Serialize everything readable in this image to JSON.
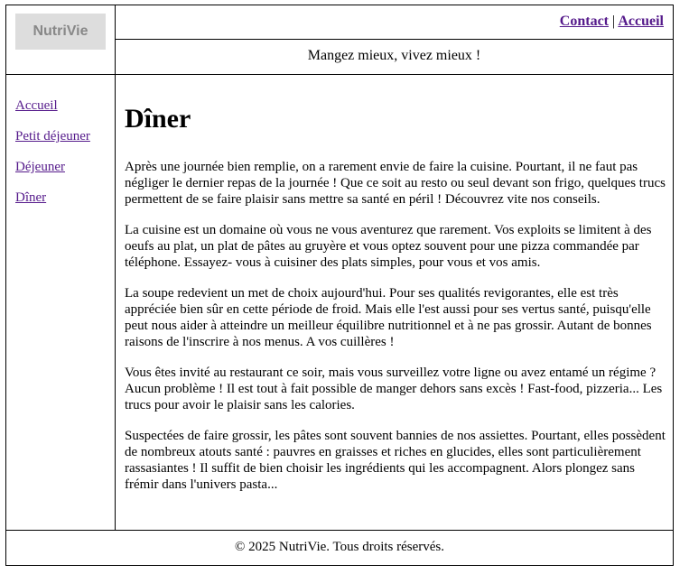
{
  "header": {
    "logo": "NutriVie",
    "nav": [
      {
        "label": "Contact"
      },
      {
        "label": "Accueil"
      }
    ],
    "separator": "|",
    "tagline": "Mangez mieux, vivez mieux !"
  },
  "sidebar": {
    "items": [
      {
        "label": "Accueil"
      },
      {
        "label": "Petit déjeuner"
      },
      {
        "label": "Déjeuner"
      },
      {
        "label": "Dîner"
      }
    ]
  },
  "main": {
    "title": "Dîner",
    "paragraphs": [
      "Après une journée bien remplie, on a rarement envie de faire la cuisine. Pourtant, il ne faut pas négliger le dernier repas de la journée ! Que ce soit au resto ou seul devant son frigo, quelques trucs permettent de se faire plaisir sans mettre sa santé en péril ! Découvrez vite nos conseils.",
      "La cuisine est un domaine où vous ne vous aventurez que rarement. Vos exploits se limitent à des oeufs au plat, un plat de pâtes au gruyère et vous optez souvent pour une pizza commandée par téléphone. Essayez- vous à cuisiner des plats simples, pour vous et vos amis.",
      "La soupe redevient un met de choix aujourd'hui. Pour ses qualités revigorantes, elle est très appréciée bien sûr en cette période de froid. Mais elle l'est aussi pour ses vertus santé, puisqu'elle peut nous aider à atteindre un meilleur équilibre nutritionnel et à ne pas grossir. Autant de bonnes raisons de l'inscrire à nos menus. A vos cuillères !",
      "Vous êtes invité au restaurant ce soir, mais vous surveillez votre ligne ou avez entamé un régime ? Aucun problème ! Il est tout à fait possible de manger dehors sans excès ! Fast-food, pizzeria... Les trucs pour avoir le plaisir sans les calories.",
      "Suspectées de faire grossir, les pâtes sont souvent bannies de nos assiettes. Pourtant, elles possèdent de nombreux atouts santé : pauvres en graisses et riches en glucides, elles sont particulièrement rassasiantes ! Il suffit de bien choisir les ingrédients qui les accompagnent. Alors plongez sans frémir dans l'univers pasta..."
    ]
  },
  "footer": {
    "text": "© 2025 NutriVie. Tous droits réservés."
  }
}
